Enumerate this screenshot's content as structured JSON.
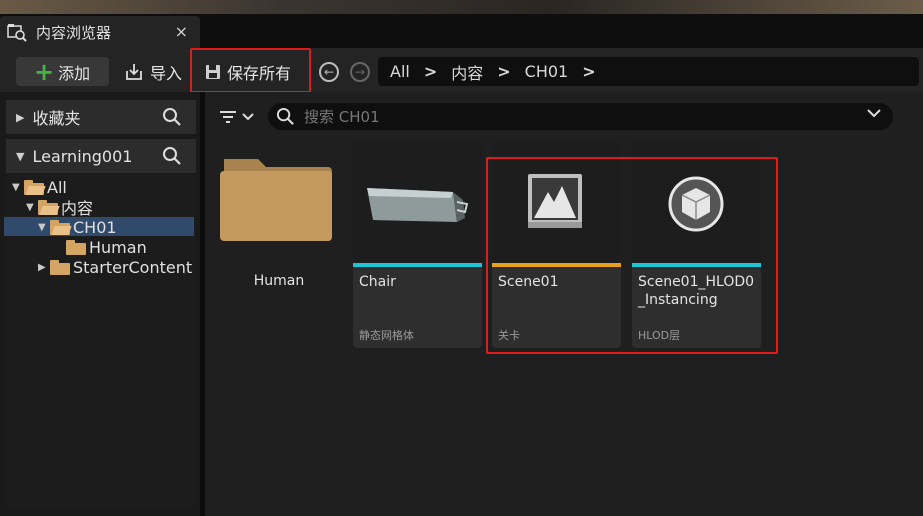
{
  "tab": {
    "title": "内容浏览器",
    "close_glyph": "×"
  },
  "toolbar": {
    "add_label": "添加",
    "import_label": "导入",
    "save_all_label": "保存所有"
  },
  "breadcrumb": {
    "items": [
      "All",
      "内容",
      "CH01"
    ],
    "separator": ">"
  },
  "sidebar": {
    "favorites_label": "收藏夹",
    "project_label": "Learning001",
    "tree": [
      {
        "label": "All",
        "depth": 0,
        "expanded": true
      },
      {
        "label": "内容",
        "depth": 1,
        "expanded": true
      },
      {
        "label": "CH01",
        "depth": 2,
        "expanded": true,
        "selected": true
      },
      {
        "label": "Human",
        "depth": 3
      },
      {
        "label": "StarterContent",
        "depth": 2,
        "expanded": false
      }
    ]
  },
  "search": {
    "placeholder": "搜索 CH01"
  },
  "assets": [
    {
      "name": "Human",
      "kind": "folder"
    },
    {
      "name": "Chair",
      "type": "静态网格体",
      "accent": "#1fc3d6"
    },
    {
      "name": "Scene01",
      "type": "关卡",
      "accent": "#e8a11c"
    },
    {
      "name": "Scene01_HLOD0_Instancing",
      "type": "HLOD层",
      "accent": "#1fc3d6"
    }
  ],
  "colors": {
    "highlight": "#e11b1b",
    "selection": "#2f4a6b",
    "folder": "#d4a463"
  }
}
